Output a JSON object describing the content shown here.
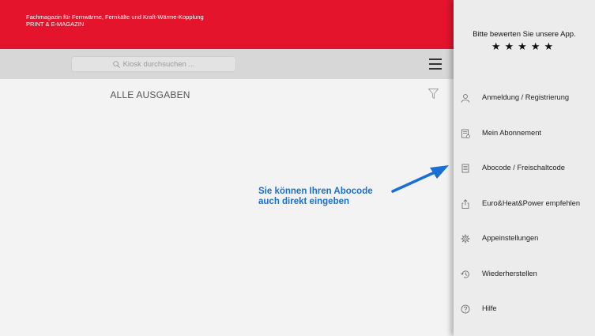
{
  "header": {
    "line1": "Fachmagazin für Fernwärme, Fernkälte und Kraft-Wärme-Kopplung",
    "line2": "PRINT & E-MAGAZIN",
    "brand_color": "#e5142d"
  },
  "search": {
    "placeholder": "Kiosk durchsuchen ..."
  },
  "main": {
    "section_title": "ALLE AUSGABEN"
  },
  "annotation": {
    "line1": "Sie können Ihren Abocode",
    "line2": "auch direkt eingeben",
    "color": "#1a6fd6"
  },
  "panel": {
    "rate_text": "Bitte bewerten Sie unsere App.",
    "stars": "★★★★★",
    "items": [
      {
        "label": "Anmeldung / Registrierung",
        "icon": "user-icon"
      },
      {
        "label": "Mein Abonnement",
        "icon": "subscription-icon"
      },
      {
        "label": "Abocode / Freischaltcode",
        "icon": "code-document-icon"
      },
      {
        "label": "Euro&Heat&Power empfehlen",
        "icon": "share-icon"
      },
      {
        "label": "Appeinstellungen",
        "icon": "gear-icon"
      },
      {
        "label": "Wiederherstellen",
        "icon": "restore-icon"
      },
      {
        "label": "Hilfe",
        "icon": "help-icon"
      }
    ]
  }
}
